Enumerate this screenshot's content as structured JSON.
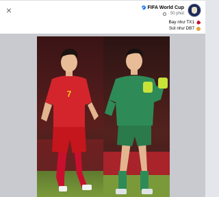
{
  "post": {
    "page_name": "FIFA World Cup",
    "timestamp": "50 phút",
    "separator": "·",
    "caption_lines": [
      "Bay như TX1",
      "Sút như DB7"
    ],
    "caption_emojis": [
      "heart-emoji",
      "flag-emoji"
    ],
    "photo": {
      "left_player": {
        "kit_color": "#d4252c",
        "number": "7"
      },
      "right_player": {
        "kit_color": "#2e8b57"
      }
    }
  },
  "icons": {
    "close": "×",
    "verified": "verified-badge-icon",
    "privacy": "globe-icon"
  }
}
